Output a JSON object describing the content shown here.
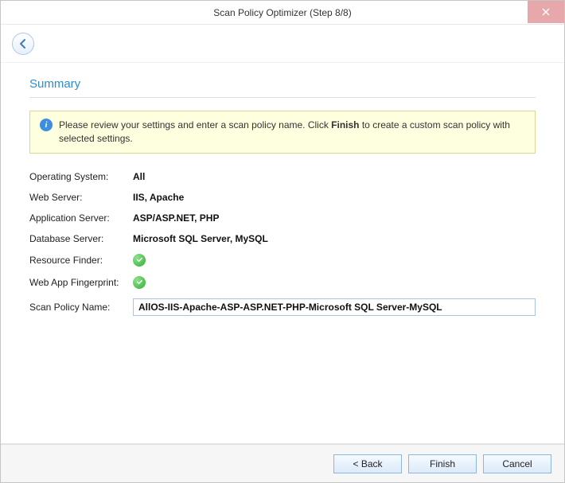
{
  "titlebar": {
    "title": "Scan Policy Optimizer (Step 8/8)"
  },
  "section": {
    "title": "Summary"
  },
  "banner": {
    "prefix": "Please review your settings and enter a scan policy name. Click ",
    "bold": "Finish",
    "suffix": " to create a custom scan policy with selected settings."
  },
  "rows": {
    "os_label": "Operating System:",
    "os_value": "All",
    "webserver_label": "Web Server:",
    "webserver_value": "IIS, Apache",
    "appserver_label": "Application Server:",
    "appserver_value": "ASP/ASP.NET, PHP",
    "dbserver_label": "Database Server:",
    "dbserver_value": "Microsoft SQL Server, MySQL",
    "resfinder_label": "Resource Finder:",
    "fingerprint_label": "Web App Fingerprint:",
    "policyname_label": "Scan Policy Name:",
    "policyname_value": "AllOS-IIS-Apache-ASP-ASP.NET-PHP-Microsoft SQL Server-MySQL"
  },
  "buttons": {
    "back": "< Back",
    "finish": "Finish",
    "cancel": "Cancel"
  }
}
